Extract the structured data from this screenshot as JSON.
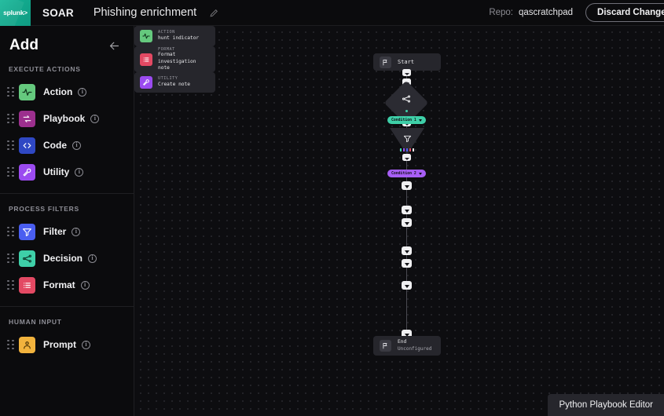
{
  "header": {
    "logo_text": "splunk",
    "logo_caret": ">",
    "app_name": "SOAR",
    "playbook_title": "Phishing enrichment",
    "edit_icon": "pencil-icon",
    "repo_label": "Repo:",
    "repo_value": "qascratchpad",
    "discard_label": "Discard Changes"
  },
  "sidebar": {
    "title": "Add",
    "back_icon": "arrow-left-icon",
    "sections": [
      {
        "category": "EXECUTE ACTIONS",
        "items": [
          {
            "label": "Action",
            "icon": "pulse-icon",
            "color": "#65c97e"
          },
          {
            "label": "Playbook",
            "icon": "loop-icon",
            "color": "#9c2f8e"
          },
          {
            "label": "Code",
            "icon": "code-icon",
            "color": "#2f48c4"
          },
          {
            "label": "Utility",
            "icon": "wrench-icon",
            "color": "#9b4bf0"
          }
        ]
      },
      {
        "category": "PROCESS FILTERS",
        "items": [
          {
            "label": "Filter",
            "icon": "funnel-icon",
            "color": "#4a5ef0"
          },
          {
            "label": "Decision",
            "icon": "branch-icon",
            "color": "#3ecfa8"
          },
          {
            "label": "Format",
            "icon": "list-icon",
            "color": "#e34963"
          }
        ]
      },
      {
        "category": "HUMAN INPUT",
        "items": [
          {
            "label": "Prompt",
            "icon": "person-icon",
            "color": "#f2b33d"
          }
        ]
      }
    ],
    "info_glyph": "i"
  },
  "canvas": {
    "start_node": {
      "label": "Start",
      "icon": "flag-icon"
    },
    "end_node": {
      "label": "End",
      "sublabel": "Unconfigured",
      "icon": "flag-icon"
    },
    "decision_node": {
      "icon": "branch-icon",
      "dot_color": "#3ecfa8"
    },
    "filter_node": {
      "icon": "funnel-icon",
      "dot_colors": [
        "#3ecfa8",
        "#9b4bf0",
        "#4a5ef0",
        "#e34963",
        "#e8e8ec"
      ]
    },
    "condition_1": {
      "label": "Condition 1",
      "color": "#3ecfa8"
    },
    "condition_2": {
      "label": "Condition 2",
      "color": "#a75ef5"
    },
    "steps": [
      {
        "kind": "ACTION",
        "name": "hunt indicator",
        "icon": "pulse-icon",
        "color": "#65c97e"
      },
      {
        "kind": "FORMAT",
        "name": "Format investigation note",
        "icon": "list-icon",
        "color": "#e34963"
      },
      {
        "kind": "UTILITY",
        "name": "Create note",
        "icon": "wrench-icon",
        "color": "#9b4bf0"
      }
    ]
  },
  "footer": {
    "python_editor_label": "Python Playbook Editor"
  }
}
